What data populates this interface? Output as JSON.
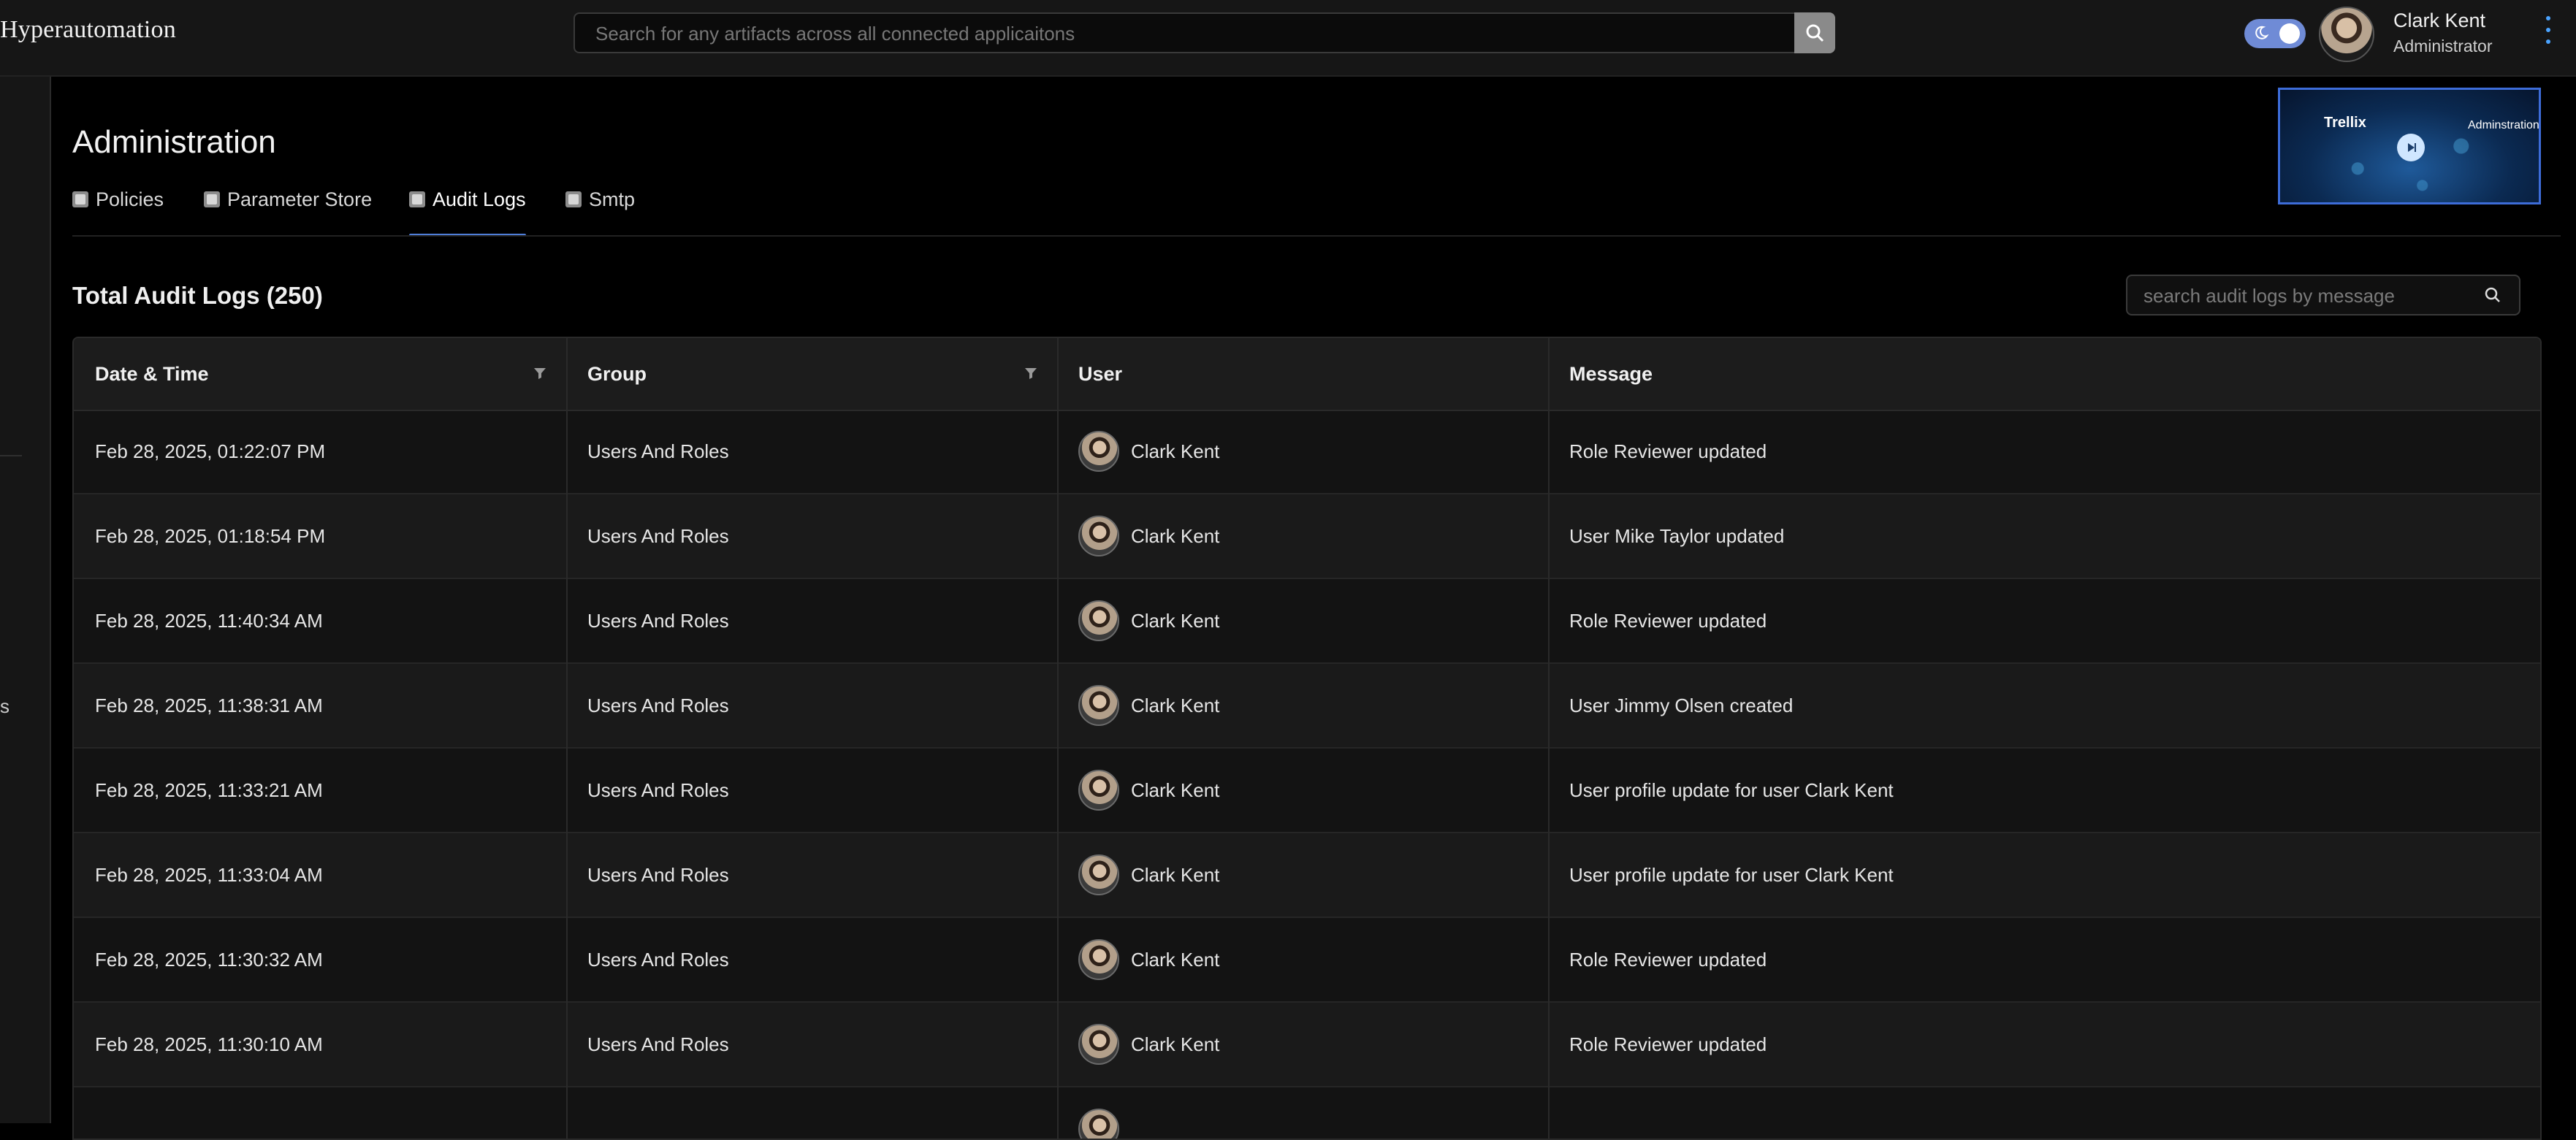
{
  "app": {
    "title": "Hyperautomation"
  },
  "search": {
    "placeholder": "Search for any artifacts across all connected applicaitons"
  },
  "user": {
    "name": "Clark Kent",
    "role": "Administrator"
  },
  "sidebar": {
    "partial_label": "s"
  },
  "page": {
    "title": "Administration"
  },
  "thumbnail": {
    "brand": "Trellix",
    "label": "Adminstration"
  },
  "tabs": [
    {
      "label": "Policies"
    },
    {
      "label": "Parameter Store"
    },
    {
      "label": "Audit Logs",
      "active": true
    },
    {
      "label": "Smtp"
    }
  ],
  "audit": {
    "title": "Total Audit Logs (250)",
    "search_placeholder": "search audit logs by message",
    "columns": [
      "Date & Time",
      "Group",
      "User",
      "Message"
    ],
    "rows": [
      {
        "datetime": "Feb 28, 2025, 01:22:07 PM",
        "group": "Users And Roles",
        "user": "Clark Kent",
        "message": "Role Reviewer updated"
      },
      {
        "datetime": "Feb 28, 2025, 01:18:54 PM",
        "group": "Users And Roles",
        "user": "Clark Kent",
        "message": "User Mike Taylor updated"
      },
      {
        "datetime": "Feb 28, 2025, 11:40:34 AM",
        "group": "Users And Roles",
        "user": "Clark Kent",
        "message": "Role Reviewer updated"
      },
      {
        "datetime": "Feb 28, 2025, 11:38:31 AM",
        "group": "Users And Roles",
        "user": "Clark Kent",
        "message": "User Jimmy Olsen created"
      },
      {
        "datetime": "Feb 28, 2025, 11:33:21 AM",
        "group": "Users And Roles",
        "user": "Clark Kent",
        "message": "User profile update for user Clark Kent"
      },
      {
        "datetime": "Feb 28, 2025, 11:33:04 AM",
        "group": "Users And Roles",
        "user": "Clark Kent",
        "message": "User profile update for user Clark Kent"
      },
      {
        "datetime": "Feb 28, 2025, 11:30:32 AM",
        "group": "Users And Roles",
        "user": "Clark Kent",
        "message": "Role Reviewer updated"
      },
      {
        "datetime": "Feb 28, 2025, 11:30:10 AM",
        "group": "Users And Roles",
        "user": "Clark Kent",
        "message": "Role Reviewer updated"
      }
    ]
  },
  "colors": {
    "accent": "#4f7ed8",
    "toggle": "#6f8bd6",
    "kebab": "#4aa3ff"
  }
}
